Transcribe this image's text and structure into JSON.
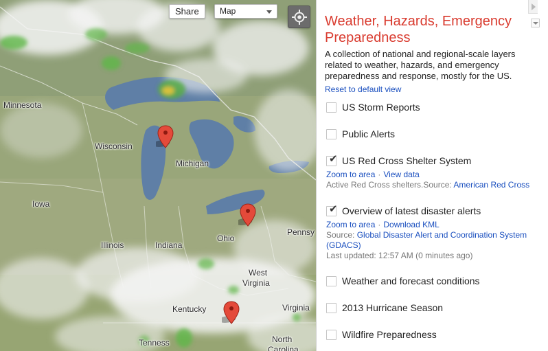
{
  "map": {
    "share_label": "Share",
    "map_type": "Map",
    "places": [
      "Minnesota",
      "Wisconsin",
      "Michigan",
      "Iowa",
      "Illinois",
      "Indiana",
      "Ohio",
      "Pennsy",
      "West",
      "Virginia",
      "Kentucky",
      "Virginia",
      "Tenness",
      "North",
      "Carolina"
    ]
  },
  "panel": {
    "title": "Weather, Hazards, Emergency Preparedness",
    "description": "A collection of national and regional-scale layers related to weather, hazards, and emergency preparedness and response, mostly for the US.",
    "reset_label": "Reset to default view",
    "layers": [
      {
        "title": "US Storm Reports",
        "checked": false
      },
      {
        "title": "Public Alerts",
        "checked": false
      },
      {
        "title": "US Red Cross Shelter System",
        "checked": true,
        "link1": "Zoom to area",
        "link2": "View data",
        "desc": "Active Red Cross shelters.Source: ",
        "source_link": "American Red Cross"
      },
      {
        "title": "Overview of latest disaster alerts",
        "checked": true,
        "link1": "Zoom to area",
        "link2": "Download KML",
        "source_prefix": "Source: ",
        "source_link": "Global Disaster Alert and Coordination System (GDACS)",
        "updated": "Last updated: 12:57 AM (0 minutes ago)"
      },
      {
        "title": "Weather and forecast conditions",
        "checked": false
      },
      {
        "title": "2013 Hurricane Season",
        "checked": false
      },
      {
        "title": "Wildfire Preparedness",
        "checked": false
      }
    ]
  },
  "icons": [
    "locate-icon",
    "marker-icon",
    "collapse-icon",
    "menu-caret-icon"
  ]
}
